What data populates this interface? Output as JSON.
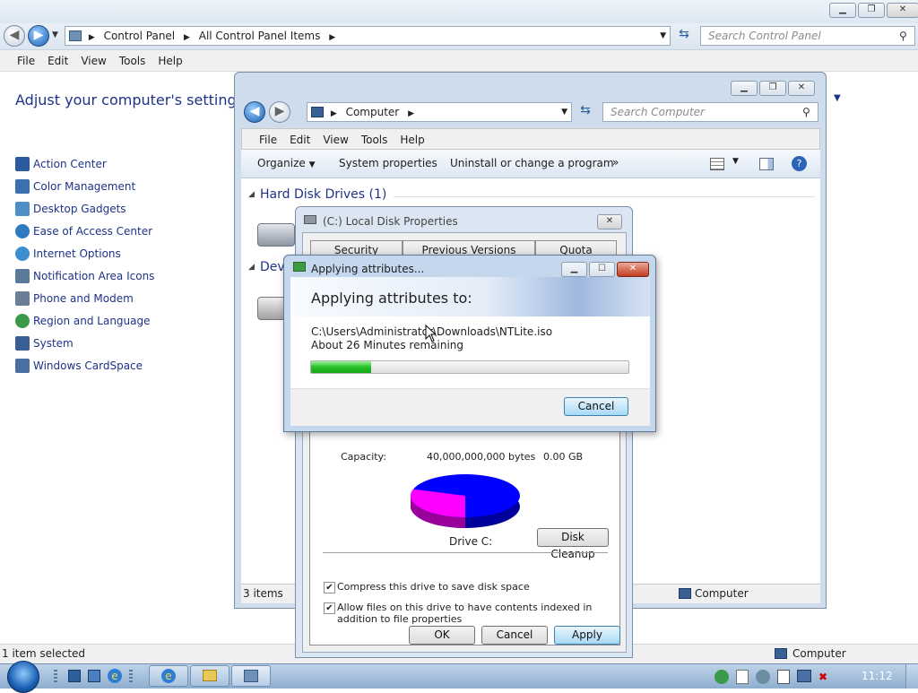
{
  "control_panel": {
    "breadcrumb": [
      "Control Panel",
      "All Control Panel Items"
    ],
    "search_placeholder": "Search Control Panel",
    "menu": [
      "File",
      "Edit",
      "View",
      "Tools",
      "Help"
    ],
    "heading": "Adjust your computer's settings",
    "items": [
      {
        "label": "Action Center",
        "icon": "flag-icon",
        "color": "#2b5aa0"
      },
      {
        "label": "Color Management",
        "icon": "monitor-icon",
        "color": "#3a6fb0"
      },
      {
        "label": "Desktop Gadgets",
        "icon": "gadgets-icon",
        "color": "#4f8fc8"
      },
      {
        "label": "Ease of Access Center",
        "icon": "accessibility-icon",
        "color": "#2f7ac0"
      },
      {
        "label": "Internet Options",
        "icon": "globe-icon",
        "color": "#3b8ed0"
      },
      {
        "label": "Notification Area Icons",
        "icon": "tray-icon",
        "color": "#5a7a9a"
      },
      {
        "label": "Phone and Modem",
        "icon": "phone-icon",
        "color": "#6a7f95"
      },
      {
        "label": "Region and Language",
        "icon": "globe-clock-icon",
        "color": "#3a9a4a"
      },
      {
        "label": "System",
        "icon": "computer-icon",
        "color": "#3a5f95"
      },
      {
        "label": "Windows CardSpace",
        "icon": "card-icon",
        "color": "#4a6fa5"
      }
    ],
    "status": "1 item selected",
    "status_right": "Computer"
  },
  "computer_window": {
    "breadcrumb": "Computer",
    "search_placeholder": "Search Computer",
    "menu": [
      "File",
      "Edit",
      "View",
      "Tools",
      "Help"
    ],
    "commands": [
      "Organize",
      "System properties",
      "Uninstall or change a program",
      "»"
    ],
    "group_hdd": "Hard Disk Drives (1)",
    "group_dev": "Dev",
    "status_left": "3 items",
    "status_right": "Computer"
  },
  "properties": {
    "title": "(C:) Local Disk Properties",
    "tabs": [
      "Security",
      "Previous Versions",
      "Quota"
    ],
    "capacity_label": "Capacity:",
    "capacity_bytes": "40,000,000,000 bytes",
    "capacity_gb": "0.00 GB",
    "drive_label": "Drive C:",
    "disk_cleanup": "Disk Cleanup",
    "compress_label": "Compress this drive to save disk space",
    "index_label": "Allow files on this drive to have contents indexed in addition to file properties",
    "ok": "OK",
    "cancel": "Cancel",
    "apply": "Apply",
    "pie": {
      "used_fraction": 0.3,
      "used_color": "#ff00ff",
      "free_color": "#0000ff"
    }
  },
  "apply_dialog": {
    "title": "Applying attributes...",
    "heading": "Applying attributes to:",
    "path": "C:\\Users\\Administrator\\Downloads\\NTLite.iso",
    "remaining": "About 26 Minutes remaining",
    "progress": 0.19,
    "cancel": "Cancel"
  },
  "taskbar": {
    "clock": "11:12"
  }
}
